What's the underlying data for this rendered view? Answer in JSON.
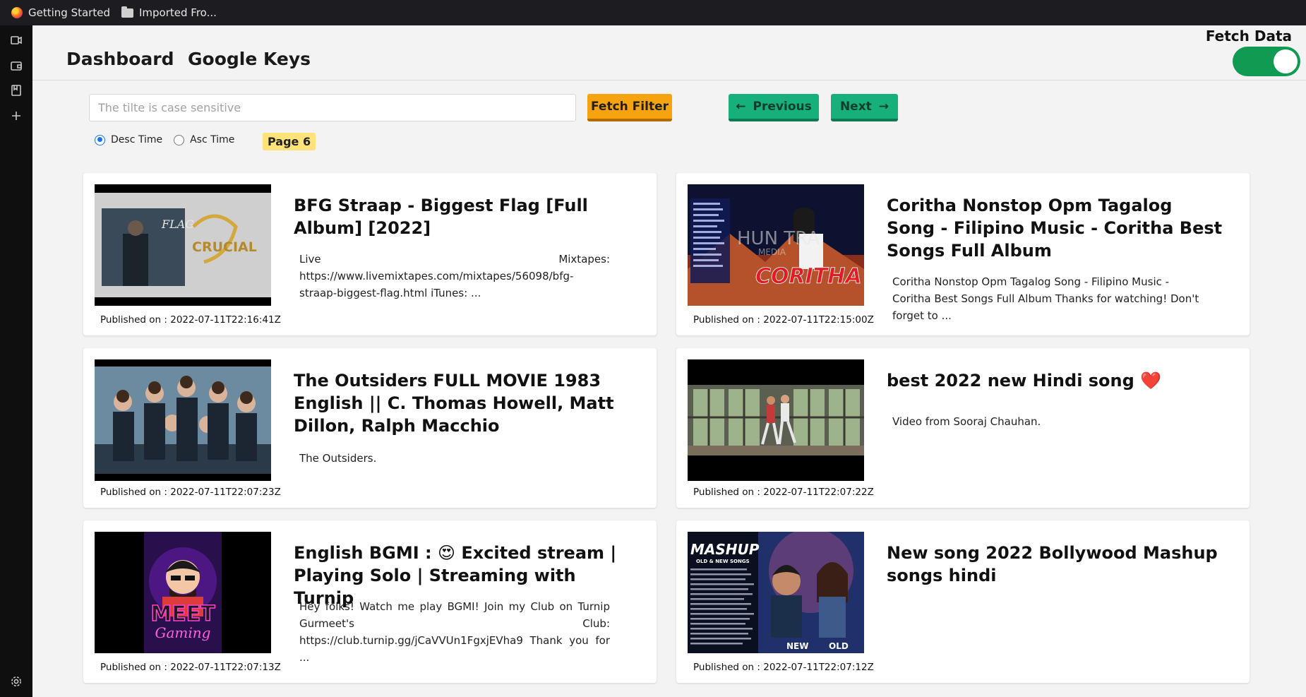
{
  "bookmarks": [
    {
      "label": "Getting Started",
      "icon": "firefox-icon"
    },
    {
      "label": "Imported Fro...",
      "icon": "folder-icon"
    }
  ],
  "sidebar": {
    "icons": [
      "video-icon",
      "wallet-icon",
      "bookmark-icon",
      "plus-icon",
      "settings-icon"
    ]
  },
  "header": {
    "nav": [
      "Dashboard",
      "Google Keys"
    ],
    "fetch_label": "Fetch Data",
    "fetch_enabled": true
  },
  "controls": {
    "search_placeholder": "The tilte is case sensitive",
    "search_value": "",
    "filter_button": "Fetch Filter",
    "prev_button": "Previous",
    "next_button": "Next",
    "sort_options": [
      "Desc Time",
      "Asc Time"
    ],
    "sort_selected": "Desc Time",
    "page_badge": "Page 6"
  },
  "colors": {
    "accent_orange": "#f5a30f",
    "accent_green": "#17b07a",
    "toggle_green": "#119a52",
    "badge_yellow": "#ffe27a"
  },
  "videos": [
    {
      "title": "BFG Straap - Biggest Flag [Full Album] [2022]",
      "description": "Live Mixtapes: https://www.livemixtapes.com/mixtapes/56098/bfg-straap-biggest-flag.html iTunes: ...",
      "published": "Published on : 2022-07-11T22:16:41Z",
      "thumbnail_text": [
        "FLAG",
        "CRUCIAL"
      ]
    },
    {
      "title": "Coritha Nonstop Opm Tagalog Song - Filipino Music - Coritha Best Songs Full Album",
      "description": "Coritha Nonstop Opm Tagalog Song - Filipino Music - Coritha Best Songs Full Album Thanks for watching! Don't forget to ...",
      "published": "Published on : 2022-07-11T22:15:00Z",
      "thumbnail_text": [
        "HUN TRA",
        "MEDIA",
        "CORITHA"
      ]
    },
    {
      "title": "The Outsiders FULL MOVIE 1983 English || C. Thomas Howell, Matt Dillon, Ralph Macchio",
      "description": "The Outsiders.",
      "published": "Published on : 2022-07-11T22:07:23Z",
      "thumbnail_text": []
    },
    {
      "title": "best 2022 new Hindi song ❤️",
      "description": "Video from Sooraj Chauhan.",
      "published": "Published on : 2022-07-11T22:07:22Z",
      "thumbnail_text": []
    },
    {
      "title": "English BGMI : 😍 Excited stream | Playing Solo | Streaming with Turnip",
      "description": "Hey folks! Watch me play BGMI! Join my Club on Turnip Gurmeet's Club: https://club.turnip.gg/jCaVVUn1FgxjEVha9 Thank you for ...",
      "published": "Published on : 2022-07-11T22:07:13Z",
      "thumbnail_text": [
        "MEET",
        "Gaming"
      ]
    },
    {
      "title": "New song 2022 Bollywood Mashup songs hindi",
      "description": "",
      "published": "Published on : 2022-07-11T22:07:12Z",
      "thumbnail_text": [
        "MASHUP",
        "OLD & NEW SONGS",
        "NEW",
        "OLD"
      ]
    }
  ]
}
